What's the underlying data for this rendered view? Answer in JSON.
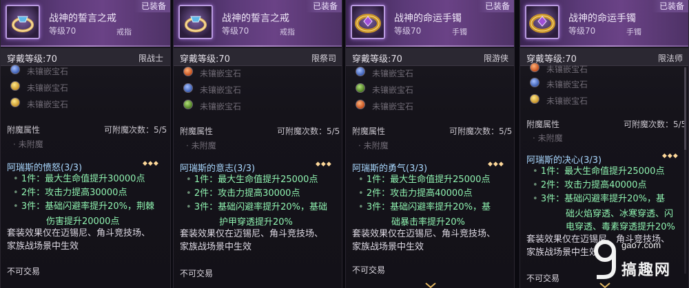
{
  "cards": [
    {
      "name": "战神的誓言之戒",
      "level": "等级70",
      "slot": "戒指",
      "equipped": "已装备",
      "wear_level": "穿戴等级:70",
      "class_tag": "限战士",
      "gems": [
        {
          "color": "blue",
          "text": "未镶嵌宝石"
        },
        {
          "color": "yellow",
          "text": "未镶嵌宝石"
        },
        {
          "color": "yellow",
          "text": "未镶嵌宝石"
        }
      ],
      "enchant_title": "附魔属性",
      "enchant_count": "可附魔次数：5/5",
      "enchant_none": "未附魔",
      "set_title": "阿瑞斯的愤怒(3/3)",
      "set_marks": "◆◆◆",
      "bonuses": [
        {
          "text": "1件：最大生命值提升30000点"
        },
        {
          "text": "2件：攻击力提高30000点"
        },
        {
          "text": "3件：基础闪避率提升20%，荆棘",
          "cont": "伤害提升20000点"
        }
      ],
      "note1": "套装效果仅在迈锡尼、角斗竞技场、",
      "note2": "家族战场景中生效",
      "trade": "不可交易",
      "accent": "#6b3fa0"
    },
    {
      "name": "战神的誓言之戒",
      "level": "等级70",
      "slot": "戒指",
      "equipped": "已装备",
      "wear_level": "穿戴等级:70",
      "class_tag": "限祭司",
      "gems": [
        {
          "color": "orange",
          "text": "未镶嵌宝石"
        },
        {
          "color": "blue",
          "text": "未镶嵌宝石"
        },
        {
          "color": "green",
          "text": "未镶嵌宝石"
        }
      ],
      "enchant_title": "附魔属性",
      "enchant_count": "可附魔次数：5/5",
      "enchant_none": "未附魔",
      "set_title": "阿瑞斯的意志(3/3)",
      "set_marks": "◆◆◆",
      "bonuses": [
        {
          "text": "1件：最大生命值提升25000点"
        },
        {
          "text": "2件：攻击力提高30000点"
        },
        {
          "text": "3件：基础闪避率提升20%，基础",
          "cont": "护甲穿透提升20%"
        }
      ],
      "note1": "套装效果仅在迈锡尼、角斗竞技场、",
      "note2": "家族战场景中生效",
      "trade": "不可交易",
      "accent": "#6b3fa0"
    },
    {
      "name": "战神的命运手镯",
      "level": "等级70",
      "slot": "手镯",
      "equipped": "已装备",
      "wear_level": "穿戴等级:70",
      "class_tag": "限游侠",
      "gems": [
        {
          "color": "blue",
          "text": "未镶嵌宝石"
        },
        {
          "color": "green",
          "text": "未镶嵌宝石"
        },
        {
          "color": "orange",
          "text": "未镶嵌宝石"
        }
      ],
      "enchant_title": "附魔属性",
      "enchant_count": "可附魔次数：5/5",
      "enchant_none": "未附魔",
      "set_title": "阿瑞斯的勇气(3/3)",
      "set_marks": "◆◆◆",
      "bonuses": [
        {
          "text": "1件：最大生命值提升25000点"
        },
        {
          "text": "2件：攻击力提高40000点"
        },
        {
          "text": "3件：基础闪避率提升20%，基",
          "cont": "础暴击率提升20%"
        }
      ],
      "note1": "套装效果仅在迈锡尼、角斗竞技场、",
      "note2": "家族战场景中生效",
      "trade": "不可交易",
      "accent": "#6b3fa0"
    },
    {
      "name": "战神的命运手镯",
      "level": "等级70",
      "slot": "手镯",
      "equipped": "已装备",
      "wear_level": "穿戴等级:70",
      "class_tag": "限法师",
      "gems": [
        {
          "color": "orange",
          "text": "未镶嵌宝石"
        },
        {
          "color": "blue",
          "text": "未镶嵌宝石"
        },
        {
          "color": "yellow",
          "text": "未镶嵌宝石"
        }
      ],
      "enchant_title": "附魔属性",
      "enchant_count": "可附魔次数：5/5",
      "enchant_none": "未附魔",
      "set_title": "阿瑞斯的决心(3/3)",
      "set_marks": "◆◆◆",
      "bonuses": [
        {
          "text": "1件：最大生命值提升25000点"
        },
        {
          "text": "2件：攻击力提高40000点"
        },
        {
          "text": "3件：基础闪避率提升20%，基",
          "cont": "础火焰穿透、冰寒穿透、闪",
          "cont2": "电穿透、毒素穿透提升20%"
        }
      ],
      "note1": "套装效果仅在迈锡尼、角斗竞技场、",
      "note2": "家族战场景中生效",
      "trade": "不可交易",
      "accent": "#6b3fa0"
    }
  ],
  "watermark": {
    "url": "gao7.com",
    "name": "搞趣网"
  }
}
